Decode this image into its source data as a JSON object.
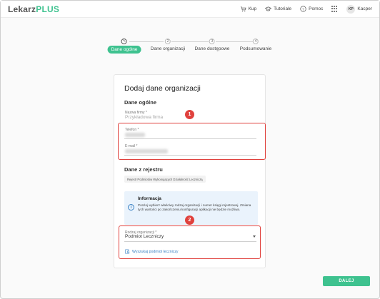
{
  "app": {
    "logo_part1": "Lekarz",
    "logo_part2": "PLUS",
    "brand_color": "#3ec28f"
  },
  "topnav": {
    "buy": "Kup",
    "tutorials": "Tutoriale",
    "help": "Pomoc",
    "avatar_initials": "KP",
    "user_name": "Kacper"
  },
  "stepper": {
    "steps": [
      {
        "number": "1",
        "label": "Dane ogólne",
        "active": true
      },
      {
        "number": "2",
        "label": "Dane organizacji",
        "active": false
      },
      {
        "number": "3",
        "label": "Dane dostępowe",
        "active": false
      },
      {
        "number": "4",
        "label": "Podsumowanie",
        "active": false
      }
    ]
  },
  "form": {
    "title": "Dodaj dane organizacji",
    "general_section": "Dane ogólne",
    "company_name_label": "Nazwa firmy *",
    "company_name_placeholder": "Przykładowa firma",
    "phone_label": "Telefon *",
    "email_label": "E-mail *",
    "registry_section": "Dane z rejestru",
    "registry_chip": "Rejestr Podmiotów Wykonujących Działalność Leczniczą",
    "info_title": "Informacja",
    "info_text": "Ponżej wybierz właściwy rodzaj organizacji i numer księgi rejestrowej. Zmiana tych wartości po zakończeniu konfiguracji aplikacji nie będzie możliwa.",
    "org_type_label": "Rodzaj organizacji *",
    "org_type_value": "Podmiot Leczniczy",
    "search_link": "Wyszukaj podmiot leczniczy"
  },
  "annotations": {
    "badge1": "1",
    "badge2": "2",
    "color": "#e0413d"
  },
  "footer": {
    "next_label": "DALEJ"
  }
}
